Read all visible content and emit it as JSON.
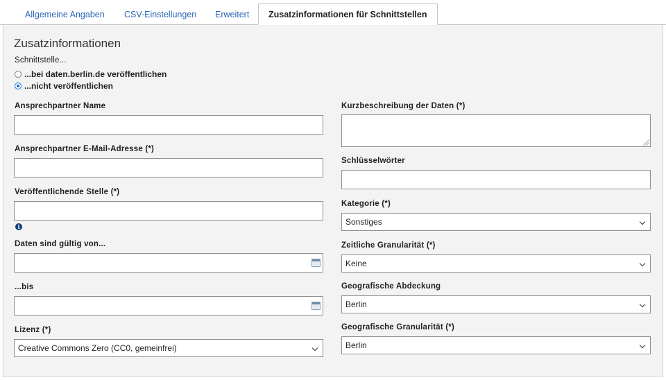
{
  "tabs": [
    {
      "label": "Allgemeine Angaben",
      "active": false
    },
    {
      "label": "CSV-Einstellungen",
      "active": false
    },
    {
      "label": "Erweitert",
      "active": false
    },
    {
      "label": "Zusatzinformationen für Schnittstellen",
      "active": true
    }
  ],
  "section": {
    "title": "Zusatzinformationen"
  },
  "publish": {
    "label": "Schnittstelle...",
    "options": [
      {
        "label": "...bei daten.berlin.de veröffentlichen",
        "checked": false
      },
      {
        "label": "...nicht veröffentlichen",
        "checked": true
      }
    ]
  },
  "left": {
    "contact_name": {
      "label": "Ansprechpartner Name",
      "value": ""
    },
    "contact_email": {
      "label": "Ansprechpartner E-Mail-Adresse (*)",
      "value": ""
    },
    "publisher": {
      "label": "Veröffentlichende Stelle (*)",
      "value": "",
      "info_icon": "info-icon"
    },
    "valid_from": {
      "label": "Daten sind gültig von...",
      "value": "",
      "icon": "calendar-icon"
    },
    "valid_to": {
      "label": "...bis",
      "value": "",
      "icon": "calendar-icon"
    },
    "license": {
      "label": "Lizenz (*)",
      "selected": "Creative Commons Zero (CC0, gemeinfrei)"
    }
  },
  "right": {
    "description": {
      "label": "Kurzbeschreibung der Daten (*)",
      "value": ""
    },
    "keywords": {
      "label": "Schlüsselwörter",
      "value": ""
    },
    "category": {
      "label": "Kategorie (*)",
      "selected": "Sonstiges"
    },
    "temporal_granularity": {
      "label": "Zeitliche Granularität (*)",
      "selected": "Keine"
    },
    "geo_coverage": {
      "label": "Geografische Abdeckung",
      "selected": "Berlin"
    },
    "geo_granularity": {
      "label": "Geografische Granularität (*)",
      "selected": "Berlin"
    }
  },
  "colors": {
    "tab_link": "#2a66b4",
    "panel_bg": "#f3f3f3",
    "radio_checked": "#1a6bd0",
    "info_icon": "#0f3e78"
  }
}
